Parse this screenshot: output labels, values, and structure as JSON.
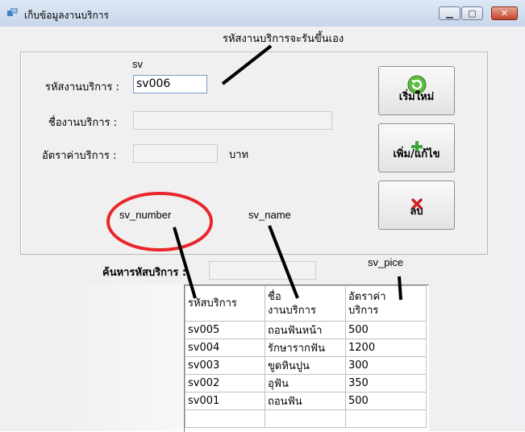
{
  "window": {
    "title": "เก็บข้อมูลงานบริการ"
  },
  "annotations": {
    "auto_note": "รหัสงานบริการจะรันขึ้นเอง",
    "sv": "sv",
    "sv_number": "sv_number",
    "sv_name": "sv_name",
    "sv_pice": "sv_pice"
  },
  "form": {
    "code_label": "รหัสงานบริการ :",
    "code_value": "sv006",
    "name_label": "ชื่องานบริการ :",
    "name_value": "",
    "rate_label": "อัตราค่าบริการ :",
    "rate_value": "",
    "rate_unit": "บาท"
  },
  "buttons": {
    "new": "เริ่มใหม่",
    "add_edit": "เพิ่ม/แก้ไข",
    "delete": "ลบ"
  },
  "search": {
    "label": "ค้นหารหัสบริการ :",
    "value": ""
  },
  "grid": {
    "headers": [
      "รหัสบริการ",
      "ชื่อ\nงานบริการ",
      "อัตราค่า\nบริการ"
    ],
    "rows": [
      [
        "sv005",
        "ถอนฟันหน้า",
        "500"
      ],
      [
        "sv004",
        "รักษารากฟัน",
        "1200"
      ],
      [
        "sv003",
        "ขูดหินปูน",
        "300"
      ],
      [
        "sv002",
        "อุฟัน",
        "350"
      ],
      [
        "sv001",
        "ถอนฟัน",
        "500"
      ]
    ]
  },
  "colors": {
    "accent_green": "#3aa63a",
    "delete_red": "#d02020",
    "annotation_red": "#e8262b"
  }
}
